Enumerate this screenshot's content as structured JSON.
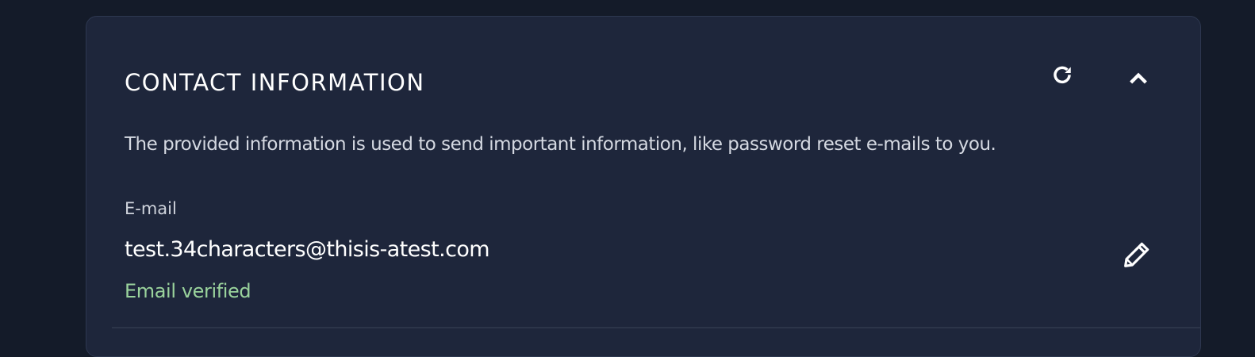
{
  "section": {
    "title": "CONTACT INFORMATION",
    "description": "The provided information is used to send important information, like password reset e-mails to you.",
    "refresh_icon": "refresh-icon",
    "collapse_icon": "chevron-up-icon"
  },
  "email": {
    "label": "E-mail",
    "value": "test.34characters@thisis-atest.com",
    "status": "Email verified",
    "edit_icon": "pencil-icon"
  },
  "colors": {
    "background": "#141b29",
    "card": "#1e263b",
    "text_primary": "#ffffff",
    "text_secondary": "#d5d9e2",
    "verified": "#9ad39c"
  }
}
